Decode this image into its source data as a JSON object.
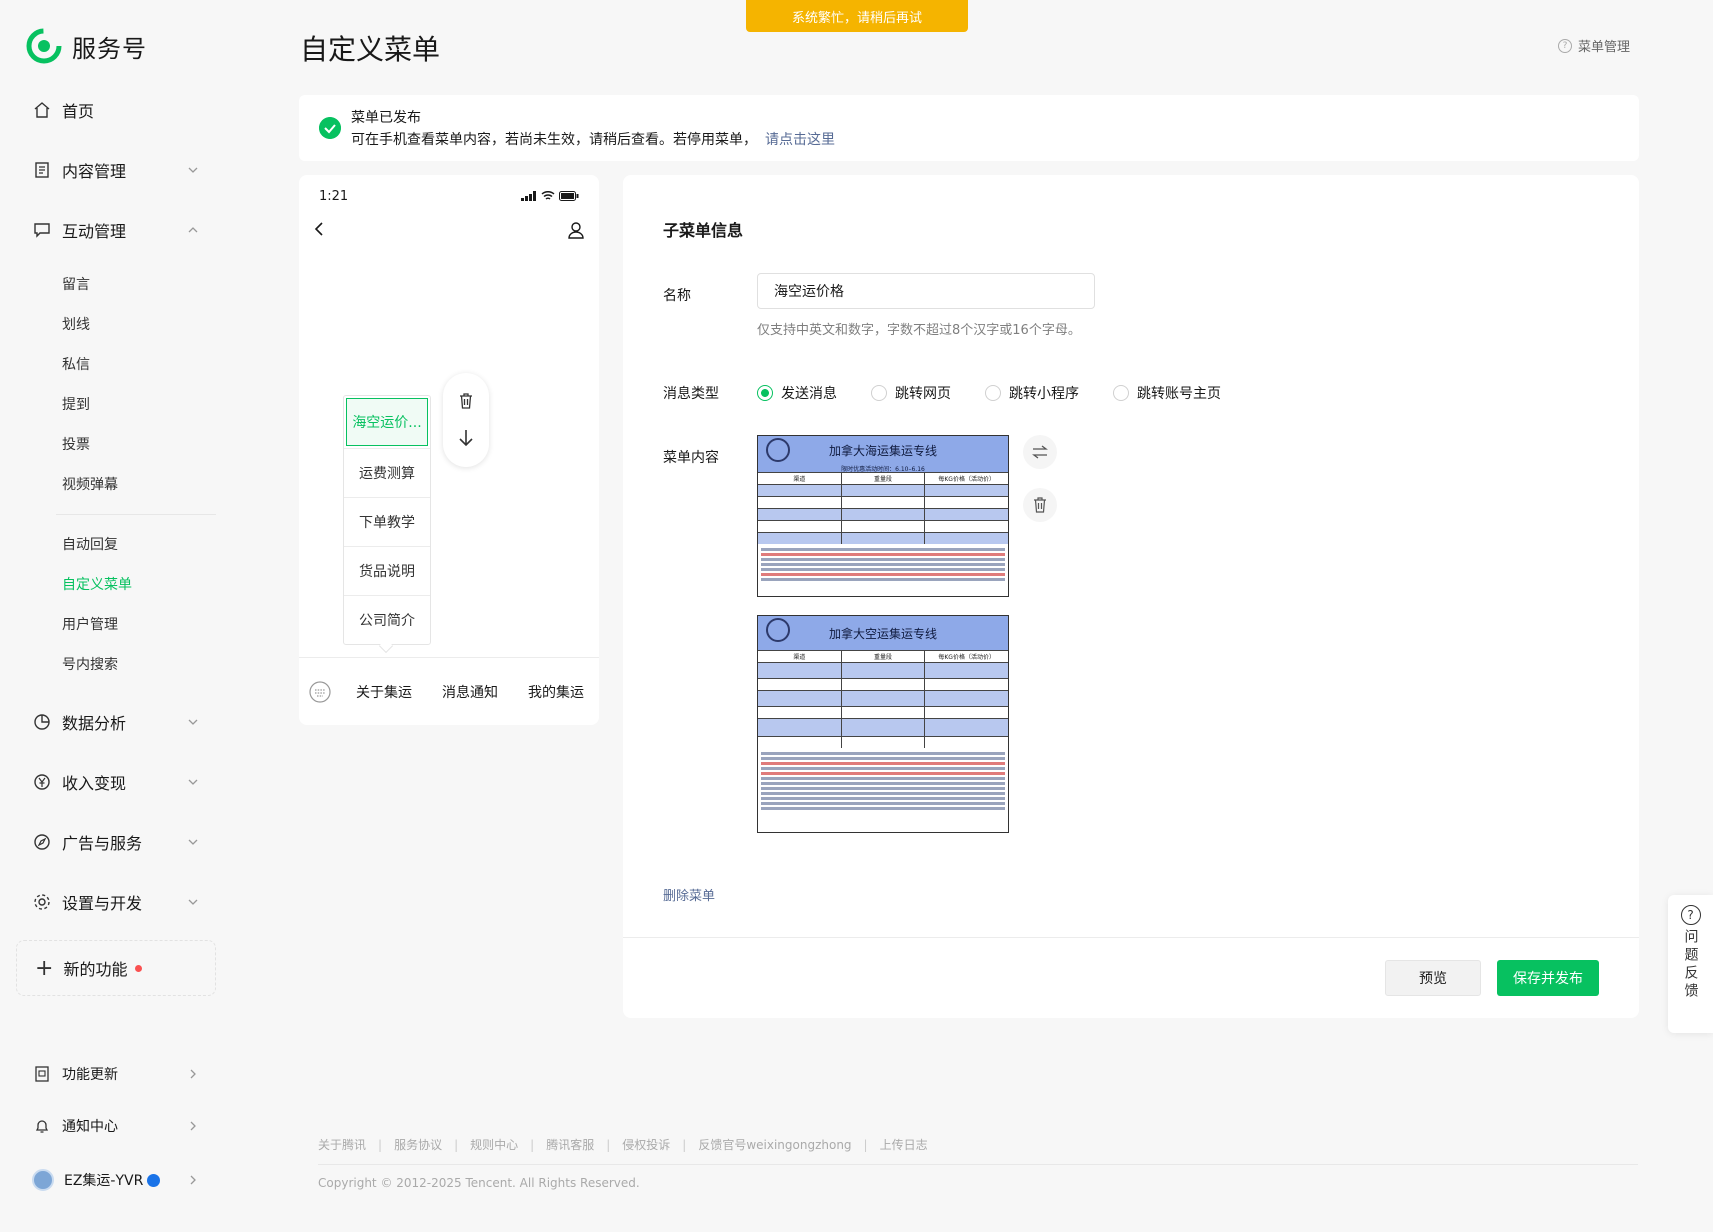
{
  "toast": "系统繁忙，请稍后再试",
  "brand": {
    "name": "服务号"
  },
  "nav": {
    "home": "首页",
    "content": "内容管理",
    "interaction": "互动管理",
    "interaction_sub": [
      "留言",
      "划线",
      "私信",
      "提到",
      "投票",
      "视频弹幕"
    ],
    "menu_sub": [
      "自动回复",
      "自定义菜单",
      "用户管理",
      "号内搜索"
    ],
    "analytics": "数据分析",
    "monetize": "收入变现",
    "ads": "广告与服务",
    "settings": "设置与开发",
    "new_features": "新的功能",
    "updates": "功能更新",
    "notifications": "通知中心",
    "account": "EZ集运-YVR"
  },
  "header": {
    "title": "自定义菜单",
    "help": "菜单管理"
  },
  "notice": {
    "title": "菜单已发布",
    "body": "可在手机查看菜单内容，若尚未生效，请稍后查看。若停用菜单，",
    "link": "请点击这里"
  },
  "phone": {
    "time": "1:21",
    "submenu": [
      "海空运价...",
      "运费测算",
      "下单教学",
      "货品说明",
      "公司简介"
    ],
    "menus": [
      "关于集运",
      "消息通知",
      "我的集运"
    ]
  },
  "editor": {
    "section_title": "子菜单信息",
    "name_label": "名称",
    "name_value": "海空运价格",
    "name_hint": "仅支持中英文和数字，字数不超过8个汉字或16个字母。",
    "type_label": "消息类型",
    "types": [
      "发送消息",
      "跳转网页",
      "跳转小程序",
      "跳转账号主页"
    ],
    "content_label": "菜单内容",
    "images": [
      {
        "title": "加拿大海运集运专线",
        "subtitle": "限时优惠活动时间：6.10–6.16",
        "headers": [
          "渠道",
          "重量段",
          "每KG价格（活动价）"
        ]
      },
      {
        "title": "加拿大空运集运专线",
        "headers": [
          "渠道",
          "重量段",
          "每KG价格（活动价）"
        ]
      }
    ],
    "delete_menu": "删除菜单",
    "preview": "预览",
    "save": "保存并发布"
  },
  "feedback": "问题反馈",
  "footer": {
    "links": [
      "关于腾讯",
      "服务协议",
      "规则中心",
      "腾讯客服",
      "侵权投诉",
      "反馈官号weixingongzhong",
      "上传日志"
    ],
    "copyright": "Copyright © 2012-2025 Tencent. All Rights Reserved."
  },
  "colors": {
    "accent": "#07c160",
    "link": "#576b95",
    "toast": "#f5b400",
    "danger": "#fa5151"
  }
}
